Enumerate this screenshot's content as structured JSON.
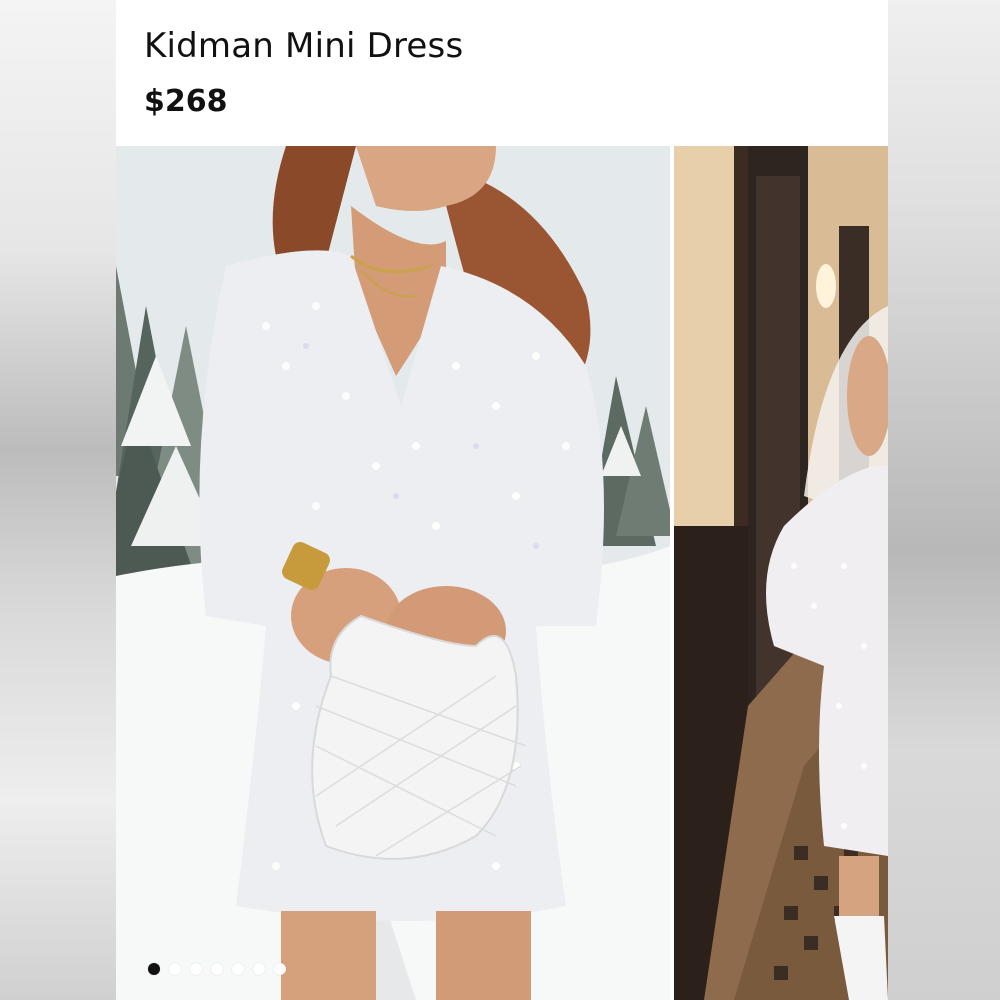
{
  "product": {
    "title": "Kidman Mini Dress",
    "price": "$268"
  },
  "gallery": {
    "images": [
      {
        "name": "photo-snow-look"
      },
      {
        "name": "photo-hallway-look"
      }
    ],
    "dots_total": 7,
    "active_index": 0,
    "colors": {
      "dot_active": "#111111",
      "dot_inactive": "#ffffff"
    }
  }
}
